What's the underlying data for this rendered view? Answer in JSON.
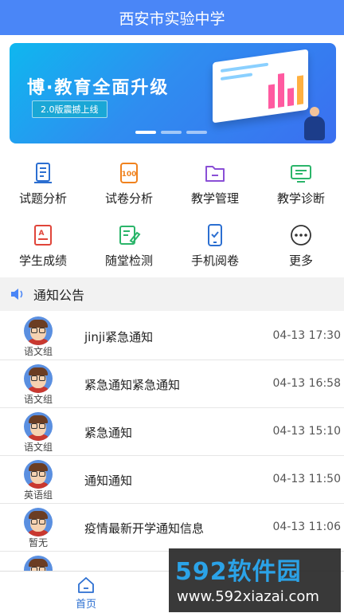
{
  "header": {
    "title": "西安市实验中学"
  },
  "banner": {
    "title": "博·教育全面升级",
    "tag": "2.0版震撼上线",
    "slides": 3,
    "active_slide": 1
  },
  "menu": {
    "items": [
      {
        "label": "试题分析",
        "icon": "document-list-icon",
        "color": "#2c6fd1"
      },
      {
        "label": "试卷分析",
        "icon": "score-100-icon",
        "color": "#f0821e"
      },
      {
        "label": "教学管理",
        "icon": "folder-icon",
        "color": "#8a4fd6"
      },
      {
        "label": "教学诊断",
        "icon": "monitor-icon",
        "color": "#2bb56a"
      },
      {
        "label": "学生成绩",
        "icon": "grade-sheet-icon",
        "color": "#e0453a"
      },
      {
        "label": "随堂检测",
        "icon": "edit-note-icon",
        "color": "#2bb56a"
      },
      {
        "label": "手机阅卷",
        "icon": "phone-check-icon",
        "color": "#2c6fd1"
      },
      {
        "label": "更多",
        "icon": "more-icon",
        "color": "#333333"
      }
    ]
  },
  "notice": {
    "heading": "通知公告",
    "items": [
      {
        "group": "语文组",
        "title": "jinji紧急通知",
        "time": "04-13 17:30"
      },
      {
        "group": "语文组",
        "title": "紧急通知紧急通知",
        "time": "04-13 16:58"
      },
      {
        "group": "语文组",
        "title": "紧急通知",
        "time": "04-13 15:10"
      },
      {
        "group": "英语组",
        "title": "通知通知",
        "time": "04-13 11:50"
      },
      {
        "group": "暂无",
        "title": "疫情最新开学通知信息",
        "time": "04-13 11:06"
      },
      {
        "group": "",
        "title": "",
        "time": ""
      }
    ]
  },
  "tabbar": {
    "home_label": "首页",
    "accent": "#2c6fd1"
  },
  "watermark": {
    "brand": "592软件园",
    "url": "www.592xiazai.com"
  }
}
